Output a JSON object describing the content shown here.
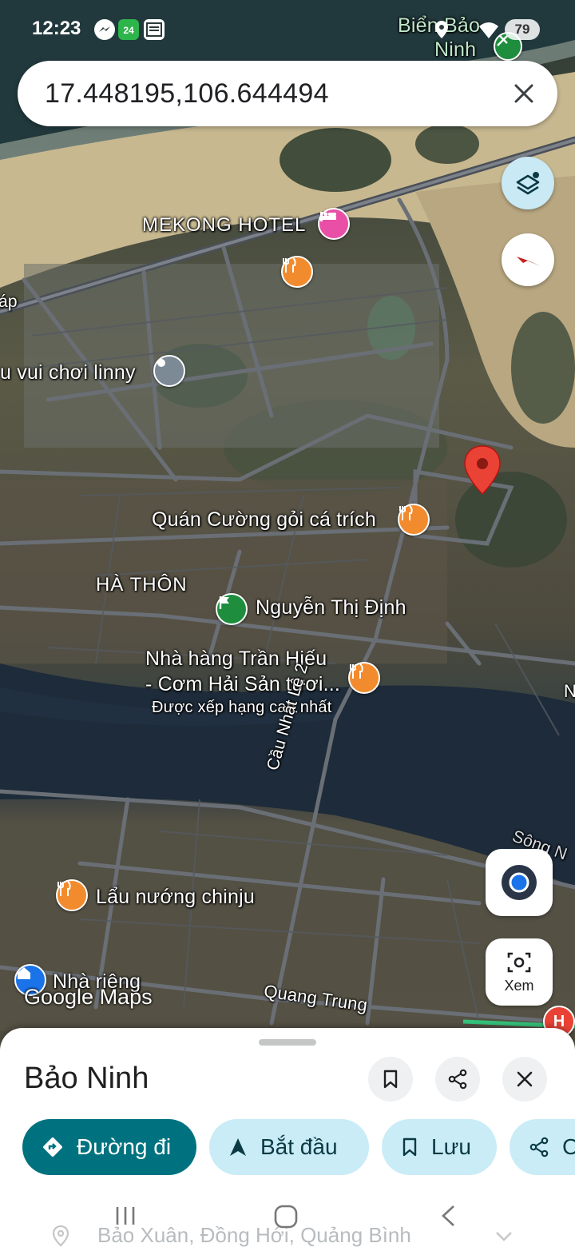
{
  "status_bar": {
    "time": "12:23",
    "battery": "79"
  },
  "search": {
    "query": "17.448195,106.644494"
  },
  "map": {
    "labels": {
      "bien_bao_ninh_line1": "Biển Bảo",
      "bien_bao_ninh_line2": "Ninh",
      "mekong_hotel": "MEKONG HOTEL",
      "khu_vui_choi": "u vui chơi linny",
      "xap": "áp",
      "quan_cuong": "Quán Cường gỏi cá trích",
      "ha_thon": "HÀ THÔN",
      "nguyen_thi_dinh": "Nguyễn Thị Định",
      "nha_hang_line1": "Nhà hàng Trần Hiếu",
      "nha_hang_line2": "- Cơm Hải Sản tươi...",
      "nha_hang_note": "Được xếp hạng cao nhất",
      "cau_nhat_le": "Cầu Nhật Lệ 2",
      "lau_nuong": "Lẩu nướng chinju",
      "nha_rieng": "Nhà riêng",
      "quang_trung": "Quang Trung",
      "song_n": "Sông N",
      "edge_n": "N"
    },
    "google_logo": "Google Maps",
    "lens_label": "Xem"
  },
  "place": {
    "title": "Bảo Ninh",
    "address": "Bảo Xuân, Đồng Hới, Quảng Bình"
  },
  "actions": {
    "directions": "Đường đi",
    "start": "Bắt đầu",
    "save": "Lưu",
    "share": "C"
  },
  "colors": {
    "accent": "#00727f",
    "chip_secondary": "#c9ecf7",
    "pin": "#ea4335",
    "poi_food": "#f28b2e",
    "poi_hotel": "#e94fa6",
    "poi_green": "#1e8e3e",
    "location_dot": "#1a73e8"
  }
}
